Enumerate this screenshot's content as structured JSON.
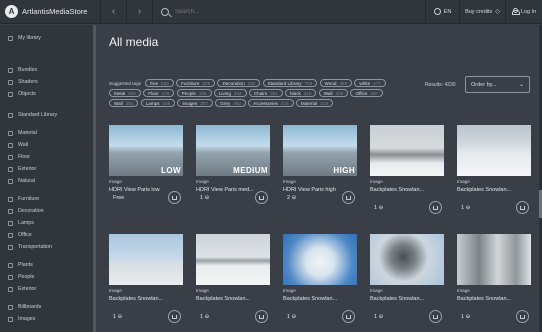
{
  "topbar": {
    "app_title": "ArtlantisMediaStore",
    "search_placeholder": "Search...",
    "language": "EN",
    "credits_label": "Buy credits",
    "login_label": "Log In"
  },
  "sidebar": {
    "items": [
      "My library",
      "Bundles",
      "Shaders",
      "Objects",
      "Standard Library",
      "Material",
      "Wall",
      "Floor",
      "Exterior",
      "Natural",
      "Furniture",
      "Decoration",
      "Lamps",
      "Office",
      "Transportation",
      "Plants",
      "People",
      "Exterior",
      "Billboards",
      "Images"
    ]
  },
  "main": {
    "title": "All media",
    "suggested_label": "Suggested tags",
    "tags": [
      {
        "name": "free",
        "count": "633"
      },
      {
        "name": "Furniture",
        "count": "625"
      },
      {
        "name": "Decoration",
        "count": "191"
      },
      {
        "name": "Standard Library",
        "count": "749"
      },
      {
        "name": "Wood",
        "count": "458"
      },
      {
        "name": "white",
        "count": "477"
      },
      {
        "name": "Metal",
        "count": "585"
      },
      {
        "name": "Floor",
        "count": "376"
      },
      {
        "name": "People",
        "count": "336"
      },
      {
        "name": "Living",
        "count": "334"
      },
      {
        "name": "Chairs",
        "count": "331"
      },
      {
        "name": "black",
        "count": "315"
      },
      {
        "name": "Wall",
        "count": "308"
      },
      {
        "name": "Office",
        "count": "297"
      },
      {
        "name": "Wall",
        "count": "281"
      },
      {
        "name": "Lamps",
        "count": "348"
      },
      {
        "name": "images",
        "count": "257"
      },
      {
        "name": "Grey",
        "count": "252"
      },
      {
        "name": "Accessories",
        "count": "223"
      },
      {
        "name": "Material",
        "count": "218"
      }
    ],
    "results": "Results: 4230",
    "order_placeholder": "Order by...",
    "cards": [
      {
        "type": "Image",
        "name": "HDRI View Paris low",
        "price": "Free",
        "badge": "LOW"
      },
      {
        "type": "Image",
        "name": "HDRI View Paris med...",
        "price": "1",
        "badge": "MEDIUM"
      },
      {
        "type": "Image",
        "name": "HDRI View Paris high",
        "price": "2",
        "badge": "HIGH"
      },
      {
        "type": "Image",
        "name": "Backplates Snowlan...",
        "price": "1",
        "badge": ""
      },
      {
        "type": "Image",
        "name": "Backplates Snowlan...",
        "price": "1",
        "badge": ""
      },
      {
        "type": "Image",
        "name": "Backplates Snowlan...",
        "price": "1",
        "badge": ""
      },
      {
        "type": "Image",
        "name": "Backplates Snowlan...",
        "price": "1",
        "badge": ""
      },
      {
        "type": "Image",
        "name": "Backplates Snowlan...",
        "price": "1",
        "badge": ""
      },
      {
        "type": "Image",
        "name": "Backplates Snowlan...",
        "price": "1",
        "badge": ""
      },
      {
        "type": "Image",
        "name": "Backplates Snowlan...",
        "price": "1",
        "badge": ""
      }
    ]
  }
}
